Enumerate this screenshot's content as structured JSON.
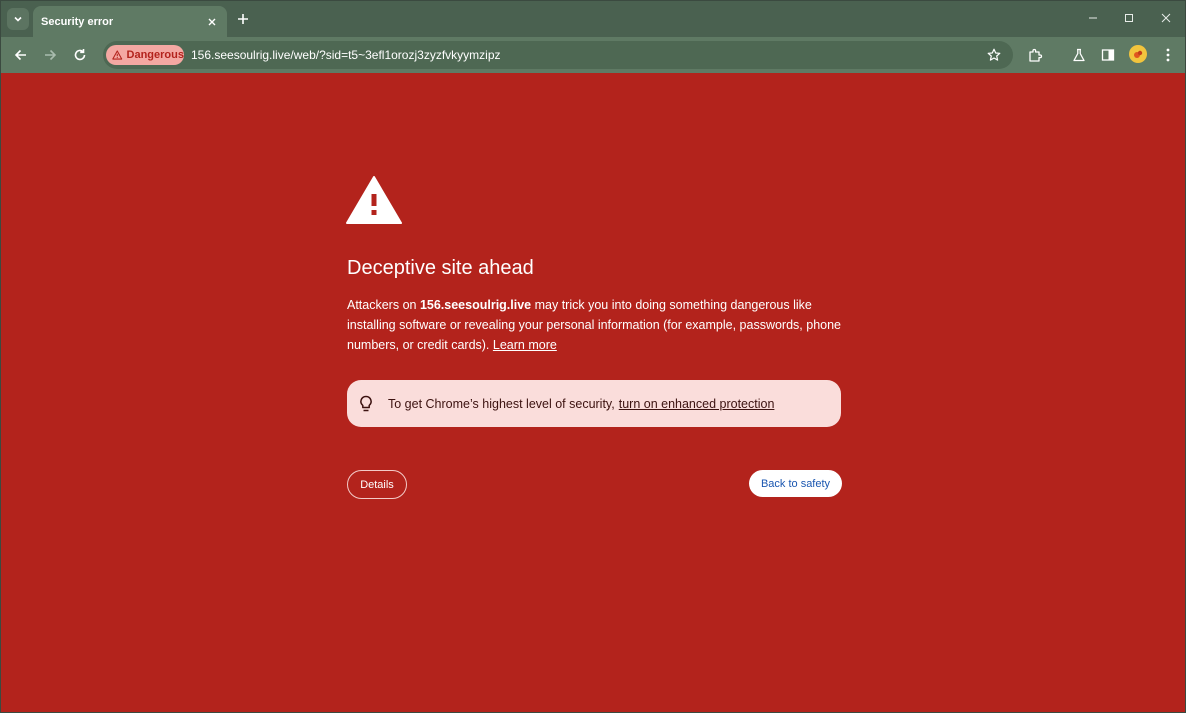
{
  "tab": {
    "title": "Security error"
  },
  "toolbar": {
    "security_chip_label": "Dangerous",
    "url": "156.seesoulrig.live/web/?sid=t5~3efl1orozj3zyzfvkyymzipz"
  },
  "page": {
    "heading": "Deceptive site ahead",
    "body_prefix": "Attackers on ",
    "site_name": "156.seesoulrig.live",
    "body_suffix": " may trick you into doing something dangerous like installing software or revealing your personal information (for example, passwords, phone numbers, or credit cards). ",
    "learn_more": "Learn more",
    "tip_text": "To get Chrome’s highest level of security,",
    "tip_link": "turn on enhanced protection",
    "details_button": "Details",
    "back_button": "Back to safety"
  },
  "colors": {
    "background": "#b3231c",
    "toolbar": "#5f7a64",
    "tabstrip": "#4a6150",
    "tip_background": "#fadddb",
    "primary_button_text": "#1a56b0"
  },
  "icons": [
    "tab-search-icon",
    "close-icon",
    "plus-icon",
    "minimize-icon",
    "maximize-icon",
    "window-close-icon",
    "back-arrow-icon",
    "forward-arrow-icon",
    "reload-icon",
    "warning-icon",
    "star-icon",
    "extensions-icon",
    "labs-icon",
    "side-panel-icon",
    "avatar-icon",
    "more-menu-icon",
    "lightbulb-icon"
  ]
}
